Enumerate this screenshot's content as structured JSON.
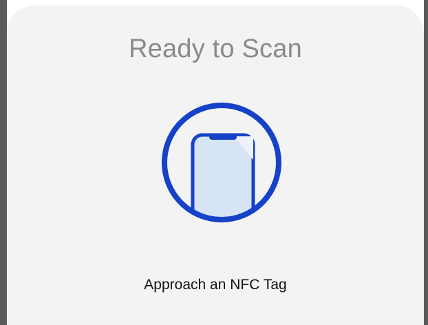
{
  "sheet": {
    "title": "Ready to Scan",
    "prompt": "Approach an NFC Tag"
  },
  "icons": {
    "scan": "phone-in-circle-icon"
  },
  "colors": {
    "accent": "#1542c8",
    "phone_fill": "#d6e4f6",
    "title": "#8a8a8e",
    "prompt": "#111111",
    "sheet_bg": "#f3f3f3",
    "edge": "#5a5a5a"
  }
}
